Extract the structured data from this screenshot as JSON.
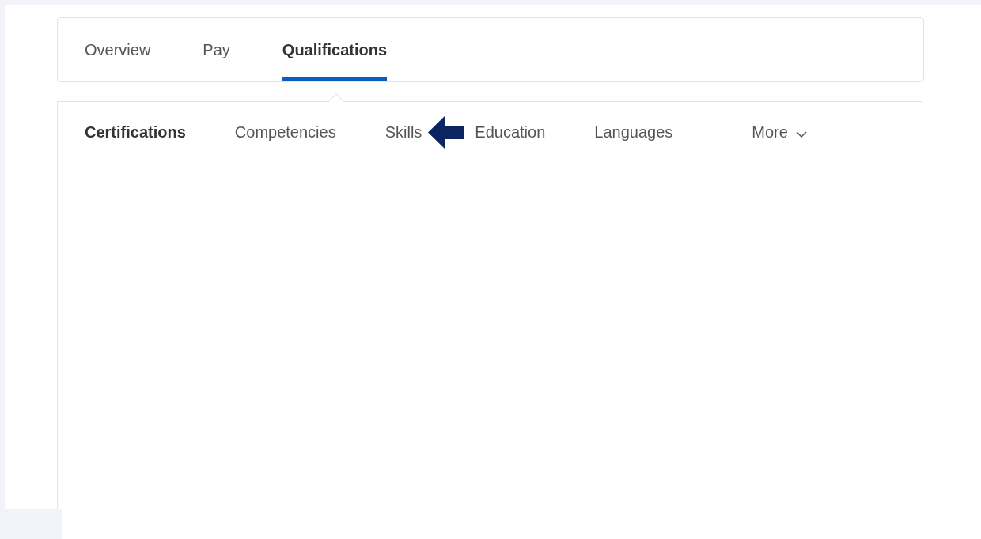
{
  "tabs": [
    {
      "label": "Overview",
      "selected": false
    },
    {
      "label": "Pay",
      "selected": false
    },
    {
      "label": "Qualifications",
      "selected": true
    }
  ],
  "sub_tabs": [
    {
      "label": "Certifications",
      "selected": true,
      "kind": "tab",
      "pointer": false
    },
    {
      "label": "Competencies",
      "selected": false,
      "kind": "tab",
      "pointer": false
    },
    {
      "label": "Skills",
      "selected": false,
      "kind": "tab",
      "pointer": true
    },
    {
      "label": "Education",
      "selected": false,
      "kind": "tab",
      "pointer": false
    },
    {
      "label": "Languages",
      "selected": false,
      "kind": "tab",
      "pointer": false
    },
    {
      "label": "More",
      "selected": false,
      "kind": "dropdown",
      "pointer": false
    }
  ]
}
